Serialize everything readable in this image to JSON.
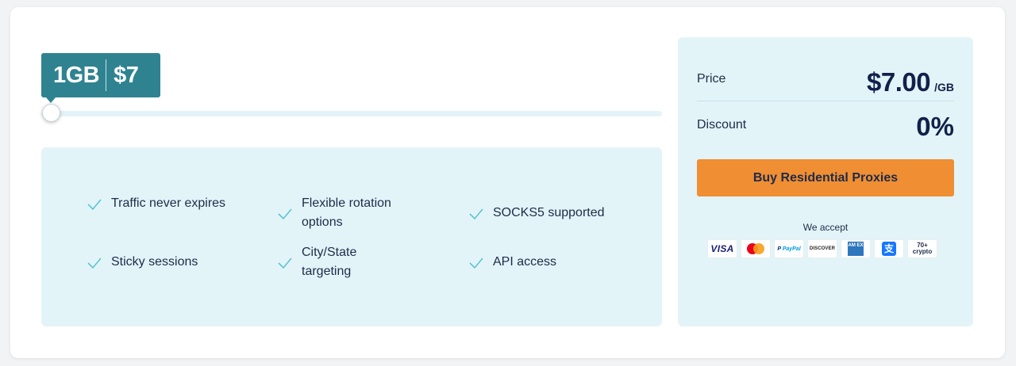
{
  "slider": {
    "amount": "1GB",
    "price": "$7",
    "level_fraction": 0.0
  },
  "features": [
    {
      "label": "Traffic never expires"
    },
    {
      "label": "Flexible rotation options"
    },
    {
      "label": "SOCKS5 supported"
    },
    {
      "label": "Sticky sessions"
    },
    {
      "label": "City/State targeting"
    },
    {
      "label": "API access"
    }
  ],
  "summary": {
    "price_label": "Price",
    "price_value": "$7.00",
    "price_unit": "/GB",
    "discount_label": "Discount",
    "discount_value": "0%",
    "buy_button": "Buy Residential Proxies",
    "accept_label": "We accept"
  },
  "payment_methods": [
    {
      "name": "visa-icon",
      "text": "VISA"
    },
    {
      "name": "mastercard-icon",
      "text": ""
    },
    {
      "name": "paypal-icon",
      "text": "PayPal"
    },
    {
      "name": "discover-icon",
      "text": "DISCOVER"
    },
    {
      "name": "amex-icon",
      "text": "AM EX"
    },
    {
      "name": "alipay-icon",
      "text": "支"
    },
    {
      "name": "crypto-icon",
      "text": "70+ crypto"
    }
  ],
  "colors": {
    "accent_teal": "#2f8390",
    "panel_bg": "#e3f4f9",
    "check_color": "#5cc5cf",
    "buy_button": "#f08e33"
  }
}
